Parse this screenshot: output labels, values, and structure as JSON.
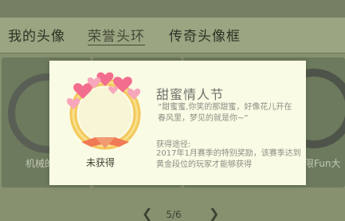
{
  "tabs": [
    {
      "label": "我的头像"
    },
    {
      "label": "荣誉头环"
    },
    {
      "label": "传奇头像框"
    }
  ],
  "grid": {
    "left_card_name": "机械的",
    "right_card_name": "限Fun大"
  },
  "modal": {
    "title": "甜蜜情人节",
    "quote": "“甜蜜蜜,你笑的那甜蜜，好像花儿开在春风里，梦见的就是你~”",
    "how_label": "获得途径:",
    "how_desc": "2017年1月赛季的特别奖励，该赛季达到黄金段位的玩家才能够获得",
    "status": "未获得"
  },
  "pager": {
    "page": "5/6",
    "prev_icon": "chevron-left-icon",
    "next_icon": "chevron-right-icon"
  }
}
